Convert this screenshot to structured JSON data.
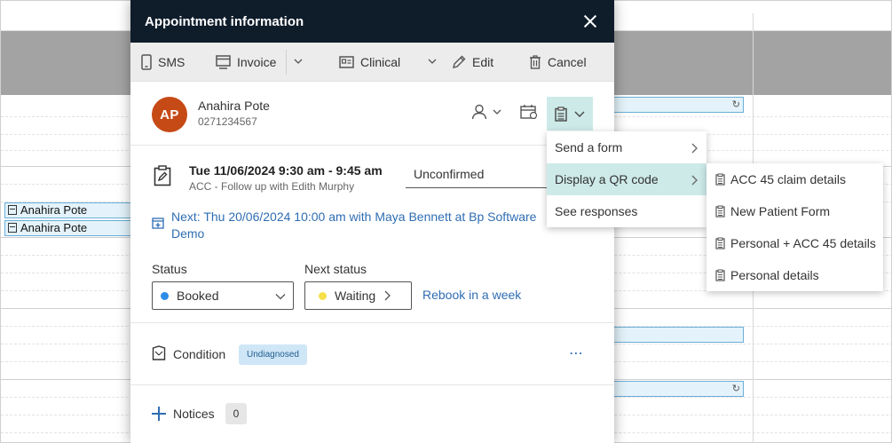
{
  "modal": {
    "title": "Appointment information",
    "toolbar": {
      "sms": "SMS",
      "invoice": "Invoice",
      "clinical": "Clinical",
      "edit": "Edit",
      "cancel": "Cancel"
    },
    "patient": {
      "initials": "AP",
      "name": "Anahira Pote",
      "phone": "0271234567",
      "avatar_color": "#c64a16"
    },
    "appointment": {
      "datetime": "Tue 11/06/2024 9:30 am - 9:45 am",
      "description": "ACC - Follow up with Edith Murphy",
      "confirmation": "Unconfirmed",
      "next": "Next: Thu 20/06/2024 10:00 am with Maya Bennett at Bp Software Demo"
    },
    "status": {
      "label": "Status",
      "value": "Booked",
      "dot_color": "#2b8de8"
    },
    "next_status": {
      "label": "Next status",
      "value": "Waiting",
      "dot_color": "#f5e04a"
    },
    "rebook_label": "Rebook in a week",
    "condition": {
      "label": "Condition",
      "badge": "Undiagnosed"
    },
    "notices": {
      "label": "Notices",
      "count": "0"
    }
  },
  "menu": {
    "items": [
      "Send a form",
      "Display a QR code",
      "See responses"
    ],
    "active_index": 1
  },
  "submenu": {
    "items": [
      "ACC 45 claim details",
      "New Patient Form",
      "Personal + ACC 45 details",
      "Personal details"
    ]
  },
  "calendar": {
    "appointments": [
      "Anahira Pote",
      "Anahira Pote"
    ]
  },
  "colors": {
    "header_bg": "#0f1d2b",
    "link": "#2f6db3",
    "highlight": "#cdeae8"
  }
}
